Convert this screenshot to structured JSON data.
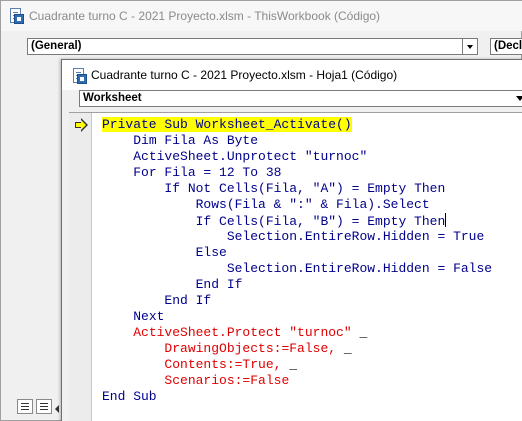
{
  "back_window": {
    "title": "Cuadrante turno C - 2021 Proyecto.xlsm - ThisWorkbook (Código)",
    "object_combo": "(General)",
    "proc_combo": "(Decla"
  },
  "front_window": {
    "title": "Cuadrante turno C - 2021 Proyecto.xlsm - Hoja1 (Código)",
    "object_combo": "Worksheet"
  },
  "code_lines": [
    {
      "indent": "",
      "parts": [
        {
          "t": "Private Sub Worksheet_Activate()",
          "c": "kw",
          "hl": true
        }
      ]
    },
    {
      "indent": "    ",
      "parts": [
        {
          "t": "Dim Fila As Byte",
          "c": "kw"
        }
      ]
    },
    {
      "indent": "    ",
      "parts": [
        {
          "t": "ActiveSheet.Unprotect \"turnoc\"",
          "c": "kw"
        }
      ]
    },
    {
      "indent": "    ",
      "parts": [
        {
          "t": "For Fila = 12 To 38",
          "c": "kw"
        }
      ]
    },
    {
      "indent": "        ",
      "parts": [
        {
          "t": "If Not Cells(Fila, \"A\") = Empty Then",
          "c": "kw"
        }
      ]
    },
    {
      "indent": "            ",
      "parts": [
        {
          "t": "Rows(Fila & \":\" & Fila).Select",
          "c": "kw"
        }
      ]
    },
    {
      "indent": "            ",
      "parts": [
        {
          "t": "If Cells(Fila, \"B\") = Empty Then",
          "c": "kw"
        }
      ],
      "caret": true
    },
    {
      "indent": "                ",
      "parts": [
        {
          "t": "Selection.EntireRow.Hidden = True",
          "c": "kw"
        }
      ]
    },
    {
      "indent": "            ",
      "parts": [
        {
          "t": "Else",
          "c": "kw"
        }
      ]
    },
    {
      "indent": "                ",
      "parts": [
        {
          "t": "Selection.EntireRow.Hidden = False",
          "c": "kw"
        }
      ]
    },
    {
      "indent": "            ",
      "parts": [
        {
          "t": "End If",
          "c": "kw"
        }
      ]
    },
    {
      "indent": "        ",
      "parts": [
        {
          "t": "End If",
          "c": "kw"
        }
      ]
    },
    {
      "indent": "    ",
      "parts": [
        {
          "t": "Next",
          "c": "kw"
        }
      ]
    },
    {
      "indent": "    ",
      "parts": [
        {
          "t": "ActiveSheet.Protect \"turnoc\"",
          "c": "err"
        },
        {
          "t": " _",
          "c": "tx"
        }
      ]
    },
    {
      "indent": "        ",
      "parts": [
        {
          "t": "DrawingObjects:=False,",
          "c": "err"
        },
        {
          "t": " _",
          "c": "tx"
        }
      ]
    },
    {
      "indent": "        ",
      "parts": [
        {
          "t": "Contents:=True,",
          "c": "err"
        },
        {
          "t": " _",
          "c": "tx"
        }
      ]
    },
    {
      "indent": "        ",
      "parts": [
        {
          "t": "Scenarios:=False",
          "c": "err"
        }
      ]
    },
    {
      "indent": "",
      "parts": [
        {
          "t": "End Sub",
          "c": "kw"
        }
      ]
    }
  ]
}
